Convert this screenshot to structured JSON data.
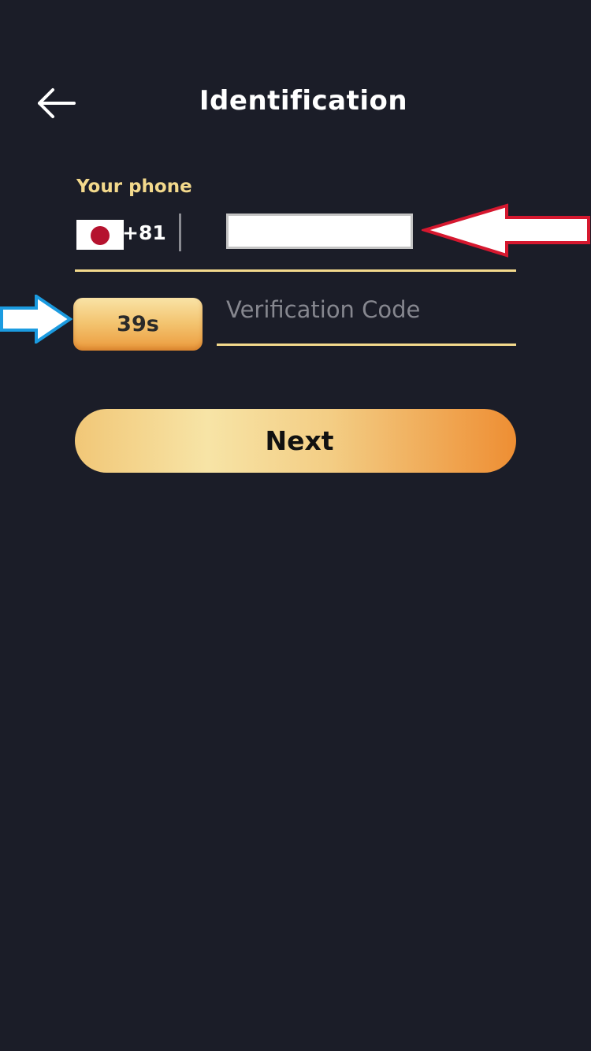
{
  "header": {
    "title": "Identification",
    "back_icon": "arrow-left-icon"
  },
  "phone": {
    "label": "Your phone",
    "flag_icon": "japan-flag-icon",
    "country_code": "+81",
    "value": ""
  },
  "verification": {
    "countdown": "39s",
    "placeholder": "Verification Code",
    "value": ""
  },
  "actions": {
    "next_label": "Next"
  },
  "annotations": {
    "red_arrow_icon": "red-outline-arrow-left-icon",
    "blue_arrow_icon": "blue-outline-arrow-right-icon"
  },
  "colors": {
    "background": "#1b1d28",
    "accent_gold": "#f3d98c",
    "title_text": "#ffffff",
    "placeholder_text": "#86878f",
    "button_gradient_start": "#f1c777",
    "button_gradient_end": "#ee8e33",
    "flag_red": "#b5122e",
    "red_arrow": "#d6182f",
    "blue_arrow": "#1b9be0"
  }
}
